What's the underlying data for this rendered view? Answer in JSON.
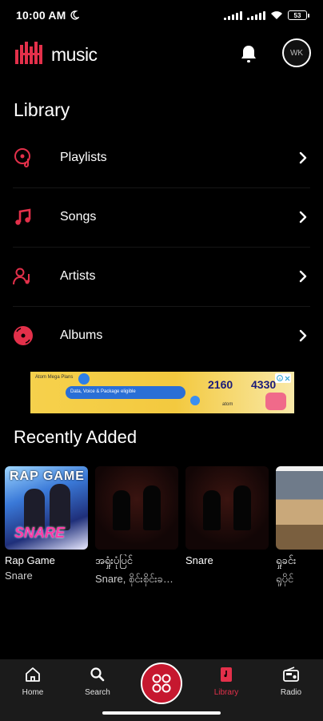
{
  "status_bar": {
    "time": "10:00 AM",
    "battery": "53"
  },
  "header": {
    "brand_word": "music",
    "avatar_initials": "WK"
  },
  "library": {
    "title": "Library",
    "items": [
      {
        "label": "Playlists",
        "icon": "playlist-disc-icon"
      },
      {
        "label": "Songs",
        "icon": "music-note-icon"
      },
      {
        "label": "Artists",
        "icon": "artist-icon"
      },
      {
        "label": "Albums",
        "icon": "album-icon"
      }
    ]
  },
  "ad": {
    "tag": "Atom Mega Plans",
    "promo": "Data, Voice & Package eligible",
    "price1": "2160",
    "price2": "4330",
    "logo_text": "atom"
  },
  "recent": {
    "title": "Recently Added",
    "items": [
      {
        "title": "Rap Game",
        "subtitle": "Snare",
        "cover_text_top": "RAP GAME",
        "cover_text_bottom": "SNARE"
      },
      {
        "title": "အရှုံးပုံပြင်",
        "subtitle": "Snare, စိုင်းစိုင်းခ…"
      },
      {
        "title": "Snare",
        "subtitle": ""
      },
      {
        "title": "ရှုခင်း",
        "subtitle": "ရှုပိုင်"
      }
    ]
  },
  "nav": {
    "items": [
      {
        "label": "Home"
      },
      {
        "label": "Search"
      },
      {
        "label": "Library"
      },
      {
        "label": "Radio"
      }
    ]
  },
  "colors": {
    "accent": "#e3304a",
    "background": "#000000",
    "nav_bg": "#1b1b1b",
    "center_button": "#c6182f"
  }
}
